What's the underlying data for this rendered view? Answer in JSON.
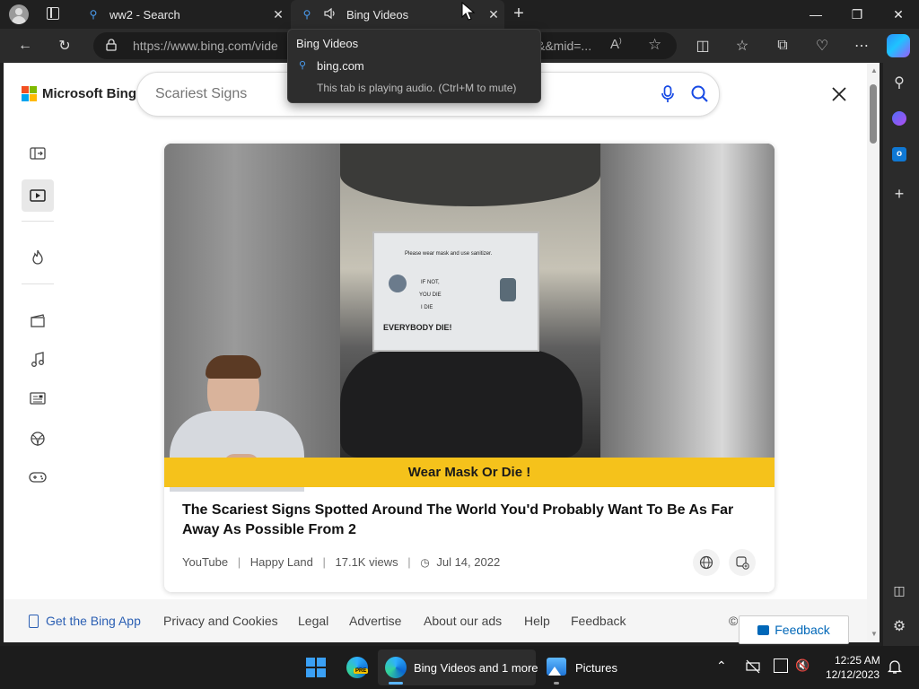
{
  "browser": {
    "tabs": [
      {
        "title": "ww2 - Search"
      },
      {
        "title": "Bing Videos"
      }
    ],
    "url": "https://www.bing.com/vide",
    "url_tail": "&&mid=..."
  },
  "tooltip": {
    "title": "Bing Videos",
    "domain": "bing.com",
    "audio_note": "This tab is playing audio. (Ctrl+M to mute)"
  },
  "bing": {
    "brand": "Microsoft Bing",
    "search_placeholder": "Scariest Signs"
  },
  "video": {
    "caption_banner": "Wear Mask Or Die !",
    "sign_lines": [
      "Please wear mask and use sanitizer.",
      "IF NOT,",
      "YOU DIE",
      "I DIE",
      "EVERYBODY DIE!"
    ],
    "title": "The Scariest Signs Spotted Around The World You'd Probably Want To Be As Far Away As Possible From 2",
    "source": "YouTube",
    "channel": "Happy Land",
    "views": "17.1K views",
    "date": "Jul 14, 2022"
  },
  "footer": {
    "links": [
      "Get the Bing App",
      "Privacy and Cookies",
      "Legal",
      "Advertise",
      "About our ads",
      "Help",
      "Feedback"
    ],
    "copyright": "©",
    "feedback_button": "Feedback"
  },
  "taskbar": {
    "edge_label": "Bing Videos and 1 more",
    "pictures_label": "Pictures",
    "time": "12:25 AM",
    "date": "12/12/2023"
  },
  "colors": {
    "accent": "#0067b8",
    "banner": "#f5c21b",
    "link": "#2b5fb3"
  }
}
